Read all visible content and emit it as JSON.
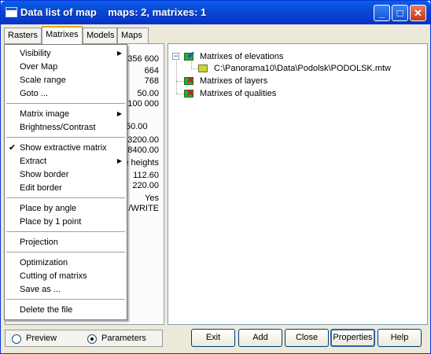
{
  "window": {
    "title": "Data list of map    maps: 2, matrixes: 1"
  },
  "tabs": [
    "Rasters",
    "Matrixes",
    "Models",
    "Maps"
  ],
  "properties": [
    {
      "value": "356 600"
    },
    {
      "value": "664"
    },
    {
      "value": "768"
    },
    {
      "value": "50.00"
    },
    {
      "value": "100 000"
    },
    {
      "value": "50.00"
    },
    {
      "value": "3200.00"
    },
    {
      "value": "8400.00"
    },
    {
      "value": "e heights"
    },
    {
      "value": "112.60"
    },
    {
      "value": "220.00"
    },
    {
      "value": "Yes"
    },
    {
      "value": "/WRITE"
    }
  ],
  "context_menu": {
    "items": [
      {
        "label": "Visibility",
        "submenu": true
      },
      {
        "label": "Over Map"
      },
      {
        "label": "Scale range"
      },
      {
        "label": "Goto ..."
      },
      {
        "label": "Matrix image",
        "submenu": true
      },
      {
        "label": "Brightness/Contrast"
      },
      {
        "label": "Show extractive matrix",
        "checked": true
      },
      {
        "label": "Extract",
        "submenu": true
      },
      {
        "label": "Show border"
      },
      {
        "label": "Edit border"
      },
      {
        "label": "Place by angle"
      },
      {
        "label": "Place by 1 point"
      },
      {
        "label": "Projection"
      },
      {
        "label": "Optimization"
      },
      {
        "label": "Cutting of matrixs"
      },
      {
        "label": "Save as ..."
      },
      {
        "label": "Delete the file"
      }
    ],
    "check_mark": "✔",
    "submenu_arrow": "▶"
  },
  "tree": {
    "root_expander": "−",
    "nodes": [
      {
        "label": "Matrixes of elevations",
        "icon": "matrix-elevations-icon"
      },
      {
        "label": "C:\\Panorama10\\Data\\Podolsk\\PODOLSK.mtw",
        "icon": "matrix-file-icon"
      },
      {
        "label": "Matrixes of layers",
        "icon": "matrix-layers-icon"
      },
      {
        "label": "Matrixes of qualities",
        "icon": "matrix-qualities-icon"
      }
    ]
  },
  "view_mode": {
    "options": [
      "Preview",
      "Parameters"
    ],
    "selected": "Parameters"
  },
  "buttons": {
    "exit": "Exit",
    "add": "Add",
    "close": "Close",
    "properties": "Properties",
    "help": "Help"
  },
  "title_buttons": {
    "minimize": "_",
    "maximize": "□",
    "close": "✕"
  },
  "colors": {
    "titlebar": "#0a47d2",
    "active_tab_accent": "#f0a400",
    "selection_red": "#e0001c",
    "icon_green": "#2ea83a"
  }
}
